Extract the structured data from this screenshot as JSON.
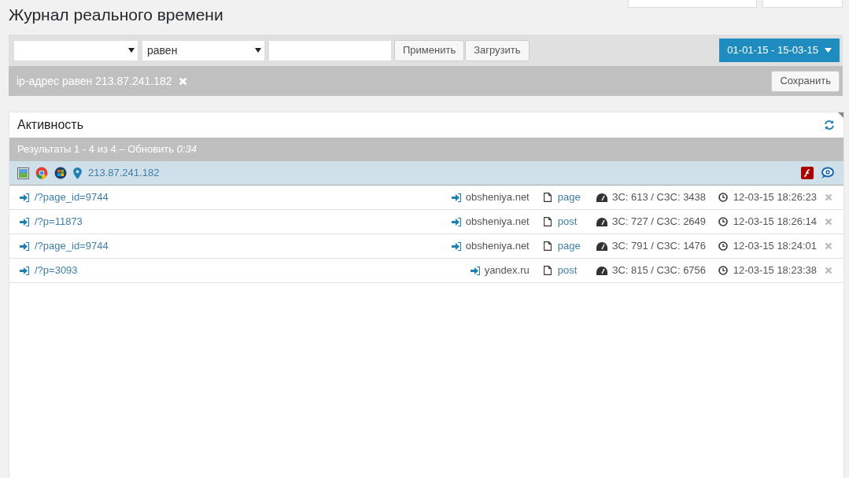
{
  "title": "Журнал реального времени",
  "filter": {
    "operator": {
      "value": "равен"
    },
    "apply": "Применить",
    "load": "Загрузить",
    "date_range": "01-01-15 - 15-03-15"
  },
  "active_filter": {
    "label": "ip-адрес равен 213.87.241.182",
    "save": "Сохранить"
  },
  "panel": {
    "title": "Активность",
    "results": {
      "text": "Результаты 1 - 4 из 4 – Обновить ",
      "timer": "0:34"
    },
    "visitor": {
      "ip": "213.87.241.182"
    },
    "rows": [
      {
        "path": "/?page_id=9744",
        "referrer": "obsheniya.net",
        "type": "page",
        "stats": "ЗС: 613 / СЗС: 3438",
        "time": "12-03-15 18:26:23"
      },
      {
        "path": "/?p=11873",
        "referrer": "obsheniya.net",
        "type": "post",
        "stats": "ЗС: 727 / СЗС: 2649",
        "time": "12-03-15 18:26:14"
      },
      {
        "path": "/?page_id=9744",
        "referrer": "obsheniya.net",
        "type": "page",
        "stats": "ЗС: 791 / СЗС: 1476",
        "time": "12-03-15 18:24:01"
      },
      {
        "path": "/?p=3093",
        "referrer": "yandex.ru",
        "type": "post",
        "stats": "ЗС: 815 / СЗС: 6756",
        "time": "12-03-15 18:23:38"
      }
    ]
  }
}
